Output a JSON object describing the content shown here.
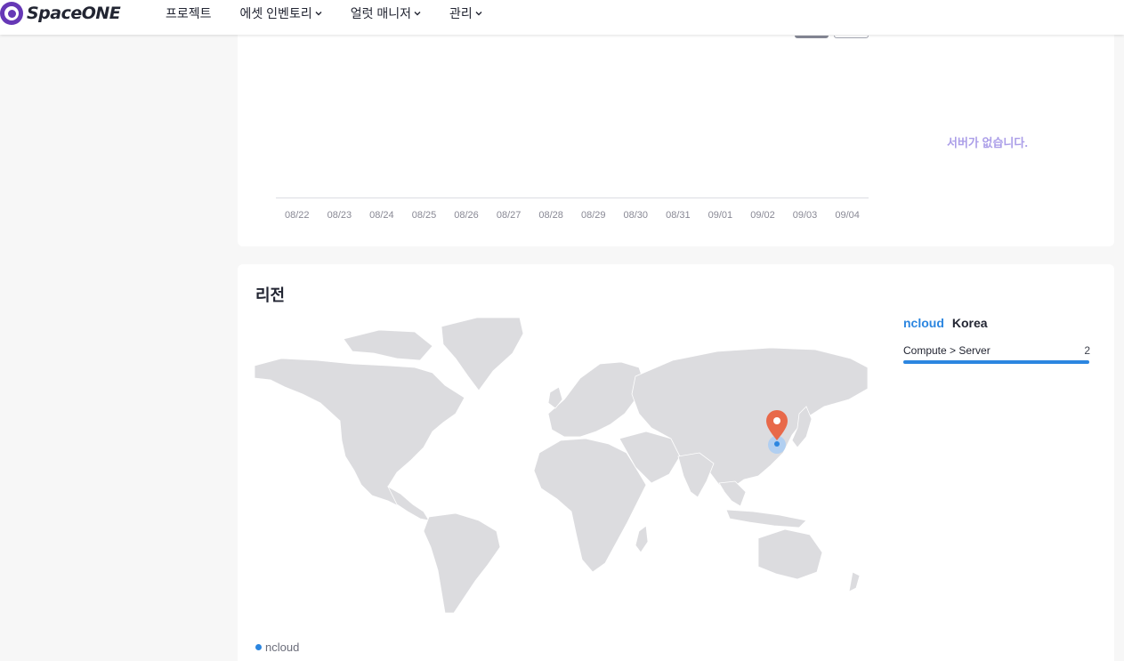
{
  "brand": {
    "logo_text": "SpaceONE",
    "accent": "#6638b6"
  },
  "nav": {
    "items": [
      {
        "label": "프로젝트",
        "has_dropdown": false
      },
      {
        "label": "에셋 인벤토리",
        "has_dropdown": true
      },
      {
        "label": "얼럿 매니저",
        "has_dropdown": true
      },
      {
        "label": "관리",
        "has_dropdown": true
      }
    ]
  },
  "trend_card": {
    "x_labels": [
      "08/22",
      "08/23",
      "08/24",
      "08/25",
      "08/26",
      "08/27",
      "08/28",
      "08/29",
      "08/30",
      "08/31",
      "09/01",
      "09/02",
      "09/03",
      "09/04"
    ],
    "empty_message": "서버가 없습니다."
  },
  "region_card": {
    "title": "리전",
    "legend": {
      "label": "ncloud",
      "color": "#2c86e0"
    },
    "marker_color": "#e8694a",
    "selected": {
      "provider": "ncloud",
      "region": "Korea",
      "rows": [
        {
          "label": "Compute > Server",
          "count": "2"
        }
      ]
    }
  }
}
